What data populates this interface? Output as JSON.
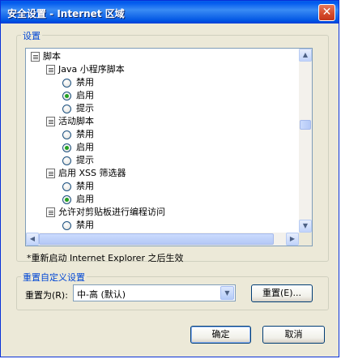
{
  "window": {
    "title": "安全设置 - Internet 区域",
    "close_icon": "close-icon"
  },
  "settings_group": {
    "label": "设置",
    "tree": [
      {
        "kind": "category",
        "label": "脚本",
        "indent": 0
      },
      {
        "kind": "category",
        "label": "Java 小程序脚本",
        "indent": 1
      },
      {
        "kind": "option",
        "label": "禁用",
        "selected": false,
        "indent": 2
      },
      {
        "kind": "option",
        "label": "启用",
        "selected": true,
        "indent": 2
      },
      {
        "kind": "option",
        "label": "提示",
        "selected": false,
        "indent": 2
      },
      {
        "kind": "category",
        "label": "活动脚本",
        "indent": 1
      },
      {
        "kind": "option",
        "label": "禁用",
        "selected": false,
        "indent": 2
      },
      {
        "kind": "option",
        "label": "启用",
        "selected": true,
        "indent": 2
      },
      {
        "kind": "option",
        "label": "提示",
        "selected": false,
        "indent": 2
      },
      {
        "kind": "category",
        "label": "启用 XSS 筛选器",
        "indent": 1
      },
      {
        "kind": "option",
        "label": "禁用",
        "selected": false,
        "indent": 2
      },
      {
        "kind": "option",
        "label": "启用",
        "selected": true,
        "indent": 2
      },
      {
        "kind": "category",
        "label": "允许对剪贴板进行编程访问",
        "indent": 1
      },
      {
        "kind": "option",
        "label": "禁用",
        "selected": false,
        "indent": 2
      }
    ],
    "note": "*重新启动 Internet Explorer 之后生效"
  },
  "reset_group": {
    "label": "重置自定义设置",
    "reset_to_label": "重置为(R):",
    "selected_level": "中-高 (默认)",
    "reset_button": "重置(E)..."
  },
  "footer": {
    "ok_button": "确定",
    "cancel_button": "取消"
  },
  "colors": {
    "titlebar": "#0054e3",
    "group_label": "#0046d5",
    "radio_selected": "#21a121",
    "dialog_bg": "#ece9d8"
  }
}
